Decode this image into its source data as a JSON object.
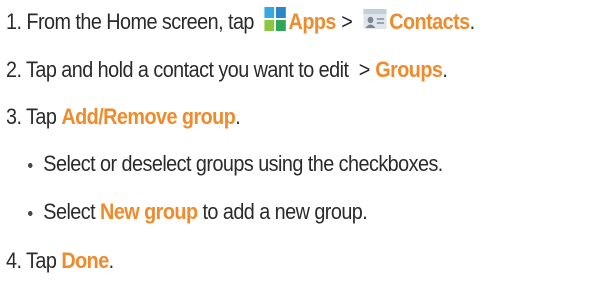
{
  "steps": [
    {
      "num": "1.",
      "pre": " From the Home screen, tap ",
      "apps_icon": "apps-grid-icon",
      "apps_label": "Apps",
      "sep": ">",
      "contacts_icon": "contacts-icon",
      "contacts_label": "Contacts",
      "end": "."
    },
    {
      "num": "2.",
      "pre": " Tap and hold a contact you want to edit ",
      "sep": ">",
      "groups_label": "Groups",
      "end": "."
    },
    {
      "num": "3.",
      "pre": " Tap ",
      "label": "Add/Remove group",
      "end": "."
    },
    {
      "num": "4.",
      "pre": " Tap ",
      "label": "Done",
      "end": "."
    }
  ],
  "bullets": [
    {
      "text": "Select or deselect groups using the checkboxes."
    },
    {
      "pre": "Select ",
      "label": "New group",
      "post": " to add a new group."
    }
  ],
  "colors": {
    "highlight": "#f08b2c",
    "body_text": "#2b2b2b"
  }
}
